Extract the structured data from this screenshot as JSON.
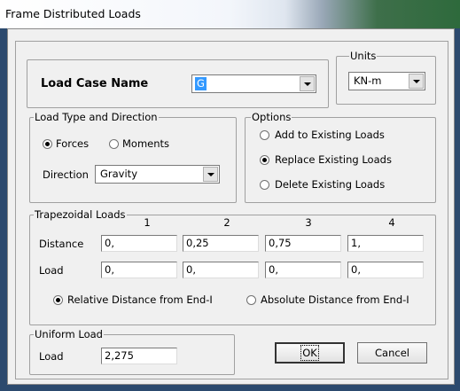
{
  "window": {
    "title": "Frame Distributed Loads"
  },
  "load_case": {
    "label": "Load Case Name",
    "value": "G"
  },
  "units": {
    "legend": "Units",
    "value": "KN-m"
  },
  "load_type": {
    "legend": "Load Type and Direction",
    "forces": "Forces",
    "moments": "Moments",
    "direction_label": "Direction",
    "direction_value": "Gravity"
  },
  "options": {
    "legend": "Options",
    "add": "Add to Existing Loads",
    "replace": "Replace Existing Loads",
    "delete": "Delete Existing Loads"
  },
  "trapezoidal": {
    "legend": "Trapezoidal Loads",
    "columns": [
      "1",
      "2",
      "3",
      "4"
    ],
    "distance_label": "Distance",
    "distances": [
      "0,",
      "0,25",
      "0,75",
      "1,"
    ],
    "load_label": "Load",
    "loads": [
      "0,",
      "0,",
      "0,",
      "0,"
    ],
    "relative": "Relative Distance from End-I",
    "absolute": "Absolute Distance from End-I"
  },
  "uniform": {
    "legend": "Uniform Load",
    "label": "Load",
    "value": "2,275"
  },
  "buttons": {
    "ok": "OK",
    "cancel": "Cancel"
  }
}
